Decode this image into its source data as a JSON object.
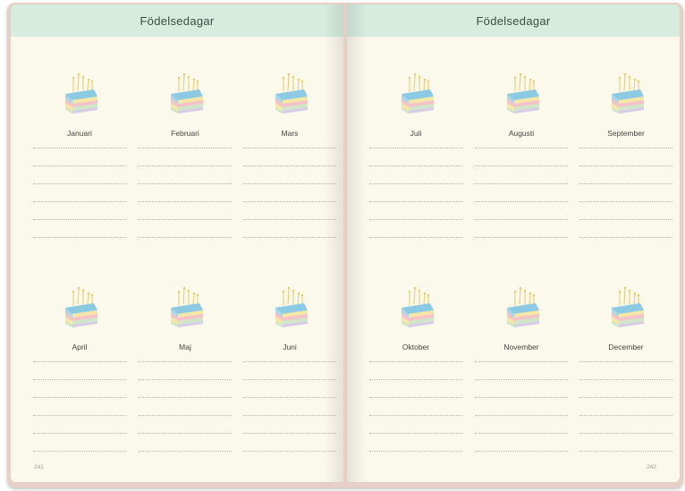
{
  "left_page": {
    "header": "Födelsedagar",
    "page_number": "241",
    "months": [
      "Januari",
      "Februari",
      "Mars",
      "April",
      "Maj",
      "Juni"
    ]
  },
  "right_page": {
    "header": "Födelsedagar",
    "page_number": "242",
    "months": [
      "Juli",
      "Augusti",
      "September",
      "Oktober",
      "November",
      "December"
    ]
  },
  "colors": {
    "header_band": "#d6ecdf",
    "page": "#fbf9ec",
    "cover": "#e7cfc6",
    "cake_blue": "#8cc9e2",
    "cake_pink": "#f3c3c8",
    "cake_yellow": "#f6e7a4",
    "candle": "#e9cf7d"
  },
  "icons": {
    "month_illustration": "birthday-cake-icon"
  }
}
